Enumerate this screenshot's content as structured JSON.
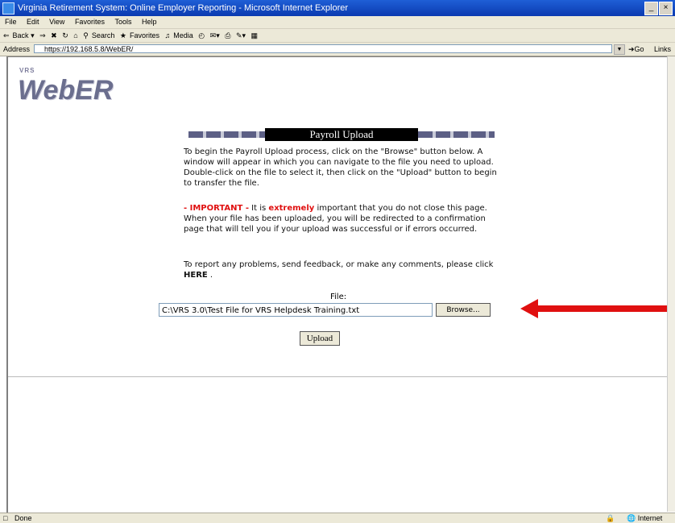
{
  "window": {
    "title": "Virginia Retirement System: Online Employer Reporting - Microsoft Internet Explorer",
    "controls": [
      "_",
      "×"
    ]
  },
  "menu": [
    "File",
    "Edit",
    "View",
    "Favorites",
    "Tools",
    "Help"
  ],
  "toolbar": {
    "back": "Back",
    "search": "Search",
    "favorites": "Favorites",
    "media": "Media"
  },
  "address": {
    "label": "Address",
    "url": "https://192.168.5.8/WebER/",
    "go": "Go",
    "links": "Links"
  },
  "logo": {
    "small": "VRS",
    "main": "WebER"
  },
  "page": {
    "title": "Payroll Upload",
    "intro": "To begin the Payroll Upload process, click on the \"Browse\" button below. A window will appear in which you can navigate to the file you need to upload. Double-click on the file to select it, then click on the \"Upload\" button to begin to transfer the file.",
    "important_label": "- IMPORTANT -",
    "important_pre": " It is ",
    "important_emph": "extremely",
    "important_post": " important that you do not close this page. When your file has been uploaded, you will be redirected to a confirmation page that will tell you if your upload was successful or if errors occurred.",
    "report_pre": "To report any problems, send feedback, or make any comments, please click ",
    "report_link": "HERE",
    "report_post": " .",
    "file_label": "File:",
    "file_value": "C:\\VRS 3.0\\Test File for VRS Helpdesk Training.txt",
    "browse_label": "Browse...",
    "upload_label": "Upload"
  },
  "status": {
    "text": "Done",
    "zone": "Internet"
  },
  "colors": {
    "annotation_arrow": "#e01010",
    "important_text": "#e01010",
    "title_box": "#000000"
  }
}
